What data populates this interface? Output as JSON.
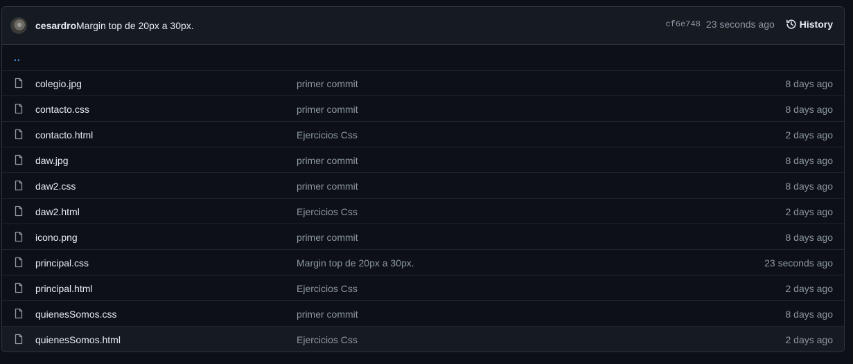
{
  "latest_commit": {
    "author": "cesardro",
    "message": "Margin top de 20px a 30px.",
    "sha": "cf6e748",
    "age": "23 seconds ago",
    "history_label": "History",
    "history_icon": "history-icon"
  },
  "parent_link": "..",
  "files": [
    {
      "name": "colegio.jpg",
      "commit": "primer commit",
      "age": "8 days ago"
    },
    {
      "name": "contacto.css",
      "commit": "primer commit",
      "age": "8 days ago"
    },
    {
      "name": "contacto.html",
      "commit": "Ejercicios Css",
      "age": "2 days ago"
    },
    {
      "name": "daw.jpg",
      "commit": "primer commit",
      "age": "8 days ago"
    },
    {
      "name": "daw2.css",
      "commit": "primer commit",
      "age": "8 days ago"
    },
    {
      "name": "daw2.html",
      "commit": "Ejercicios Css",
      "age": "2 days ago"
    },
    {
      "name": "icono.png",
      "commit": "primer commit",
      "age": "8 days ago"
    },
    {
      "name": "principal.css",
      "commit": "Margin top de 20px a 30px.",
      "age": "23 seconds ago"
    },
    {
      "name": "principal.html",
      "commit": "Ejercicios Css",
      "age": "2 days ago"
    },
    {
      "name": "quienesSomos.css",
      "commit": "primer commit",
      "age": "8 days ago"
    },
    {
      "name": "quienesSomos.html",
      "commit": "Ejercicios Css",
      "age": "2 days ago"
    }
  ],
  "colors": {
    "background": "#0d1117",
    "header_bg": "#161b22",
    "border": "#30363d",
    "text": "#e6edf3",
    "muted": "#8d96a0",
    "link": "#4493f8"
  }
}
